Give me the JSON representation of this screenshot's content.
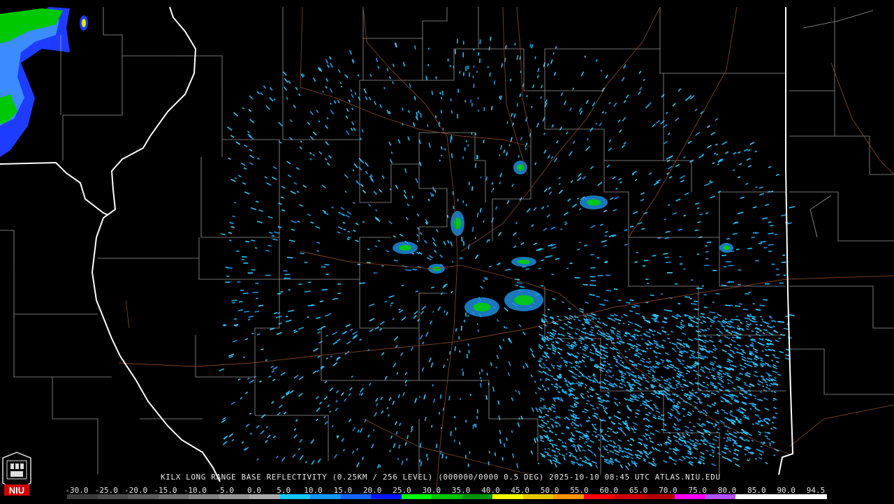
{
  "caption": "KILX LONG RANGE BASE REFLECTIVITY (0.25KM / 256 LEVEL) (000000/0000 0.5 DEG) 2025-10-10 08:45 UTC  ATLAS.NIU.EDU",
  "logo_text": "NIU",
  "scale": {
    "labels": [
      "-30.0",
      "-25.0",
      "-20.0",
      "-15.0",
      "-10.0",
      "-5.0",
      "0.0",
      "5.0",
      "10.0",
      "15.0",
      "20.0",
      "25.0",
      "30.0",
      "35.0",
      "40.0",
      "45.0",
      "50.0",
      "55.0",
      "60.0",
      "65.0",
      "70.0",
      "75.0",
      "80.0",
      "85.0",
      "90.0",
      "94.5"
    ],
    "colors": [
      "#3a3a3a",
      "#4a4a4a",
      "#5a5a5a",
      "#6e6e6e",
      "#828282",
      "#969696",
      "#aaaaaa",
      "#14c8ff",
      "#1496ff",
      "#1464ff",
      "#0018ff",
      "#00ff00",
      "#00c800",
      "#009600",
      "#ffff00",
      "#e6c800",
      "#ff9600",
      "#ff0000",
      "#d20000",
      "#b40000",
      "#ff00ff",
      "#b450ff",
      "#ffffff",
      "#ffffff",
      "#ffffff"
    ]
  }
}
